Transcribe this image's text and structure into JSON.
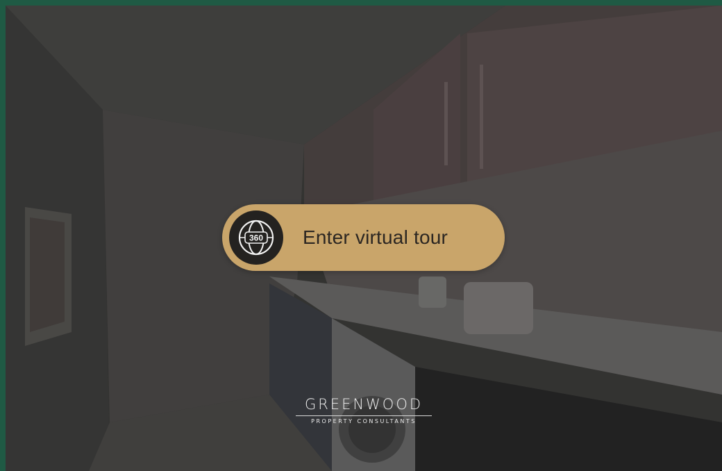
{
  "tour_button": {
    "label": "Enter virtual tour",
    "icon": "360-globe-icon",
    "icon_text": "360"
  },
  "brand": {
    "name": "GREENWOOD",
    "tagline": "PROPERTY CONSULTANTS"
  },
  "colors": {
    "frame": "#1f5a44",
    "button": "#c9a56a",
    "icon_bg": "#242220"
  }
}
